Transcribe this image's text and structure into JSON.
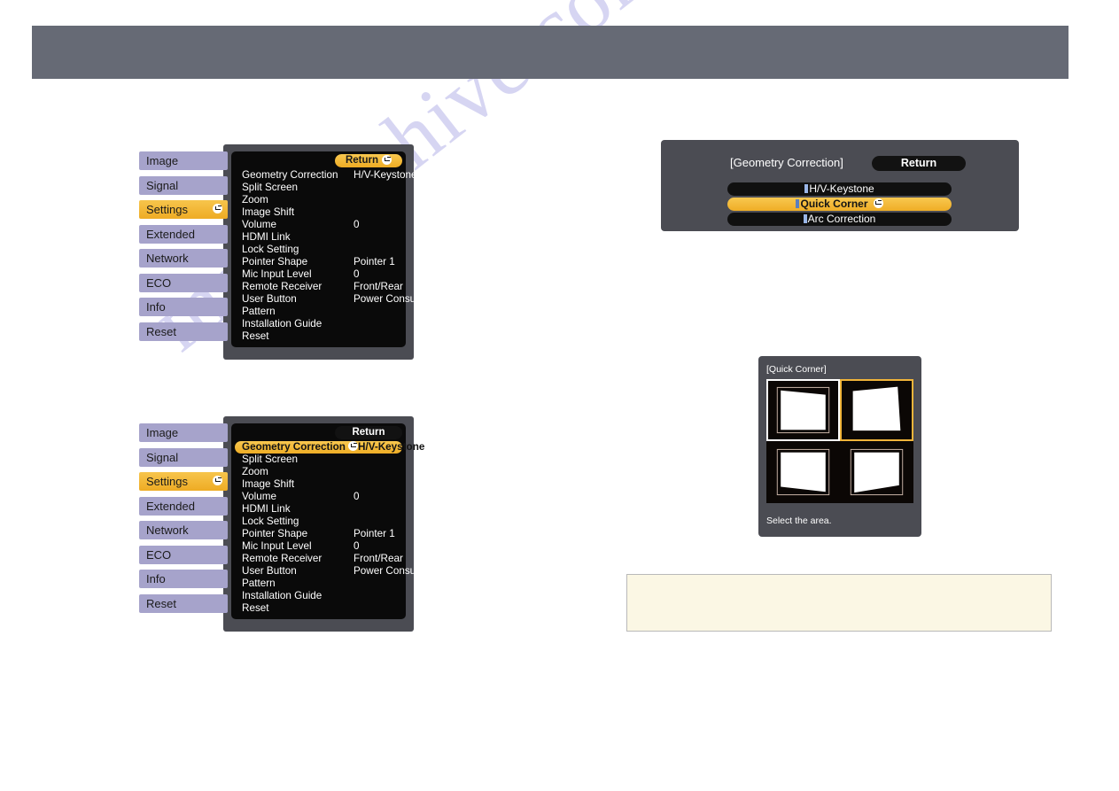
{
  "page": {
    "watermark": "manualshive.com",
    "background_color": "#ffffff",
    "header_band_color": "#666a75"
  },
  "icons": {
    "enter": "enter-key-icon"
  },
  "colors": {
    "accent_amber": "#efad26",
    "sidebar_lavender": "#a6a3cb",
    "panel_gray": "#4b4c53",
    "list_black": "#0a0a0a",
    "note_cream": "#fbf7e4"
  },
  "sidebar": {
    "items": [
      {
        "label": "Image",
        "active": false
      },
      {
        "label": "Signal",
        "active": false
      },
      {
        "label": "Settings",
        "active": true
      },
      {
        "label": "Extended",
        "active": false
      },
      {
        "label": "Network",
        "active": false
      },
      {
        "label": "ECO",
        "active": false
      },
      {
        "label": "Info",
        "active": false
      },
      {
        "label": "Reset",
        "active": false
      }
    ]
  },
  "settings_menu_1": {
    "return_label": "Return",
    "return_style": "amber",
    "rows": [
      {
        "label": "Geometry Correction",
        "value": "H/V-Keystone",
        "selected": false
      },
      {
        "label": "Split Screen",
        "value": "",
        "selected": false
      },
      {
        "label": "Zoom",
        "value": "",
        "selected": false
      },
      {
        "label": "Image Shift",
        "value": "",
        "selected": false
      },
      {
        "label": "Volume",
        "value": "0",
        "selected": false
      },
      {
        "label": "HDMI Link",
        "value": "",
        "selected": false
      },
      {
        "label": "Lock Setting",
        "value": "",
        "selected": false
      },
      {
        "label": "Pointer Shape",
        "value": "Pointer 1",
        "selected": false
      },
      {
        "label": "Mic Input Level",
        "value": "0",
        "selected": false
      },
      {
        "label": "Remote Receiver",
        "value": "Front/Rear",
        "selected": false
      },
      {
        "label": "User Button",
        "value": "Power Consum...",
        "selected": false
      },
      {
        "label": "Pattern",
        "value": "",
        "selected": false
      },
      {
        "label": "Installation Guide",
        "value": "",
        "selected": false
      },
      {
        "label": "Reset",
        "value": "",
        "selected": false
      }
    ]
  },
  "settings_menu_2": {
    "return_label": "Return",
    "return_style": "dark",
    "rows": [
      {
        "label": "Geometry Correction",
        "value": "H/V-Keystone",
        "selected": true
      },
      {
        "label": "Split Screen",
        "value": "",
        "selected": false
      },
      {
        "label": "Zoom",
        "value": "",
        "selected": false
      },
      {
        "label": "Image Shift",
        "value": "",
        "selected": false
      },
      {
        "label": "Volume",
        "value": "0",
        "selected": false
      },
      {
        "label": "HDMI Link",
        "value": "",
        "selected": false
      },
      {
        "label": "Lock Setting",
        "value": "",
        "selected": false
      },
      {
        "label": "Pointer Shape",
        "value": "Pointer 1",
        "selected": false
      },
      {
        "label": "Mic Input Level",
        "value": "0",
        "selected": false
      },
      {
        "label": "Remote Receiver",
        "value": "Front/Rear",
        "selected": false
      },
      {
        "label": "User Button",
        "value": "Power Consum...",
        "selected": false
      },
      {
        "label": "Pattern",
        "value": "",
        "selected": false
      },
      {
        "label": "Installation Guide",
        "value": "",
        "selected": false
      },
      {
        "label": "Reset",
        "value": "",
        "selected": false
      }
    ]
  },
  "geometry_dialog": {
    "title": "[Geometry Correction]",
    "return_label": "Return",
    "options": [
      {
        "label": "H/V-Keystone",
        "selected": false
      },
      {
        "label": "Quick Corner",
        "selected": true
      },
      {
        "label": "Arc Correction",
        "selected": false
      }
    ]
  },
  "quick_corner": {
    "title": "[Quick Corner]",
    "footer": "Select the area.",
    "cells": [
      {
        "position": "top-left",
        "selected": false,
        "outlined": true
      },
      {
        "position": "top-right",
        "selected": true,
        "outlined": false
      },
      {
        "position": "bottom-left",
        "selected": false,
        "outlined": false
      },
      {
        "position": "bottom-right",
        "selected": false,
        "outlined": false
      }
    ]
  },
  "note_box": {
    "text": ""
  }
}
